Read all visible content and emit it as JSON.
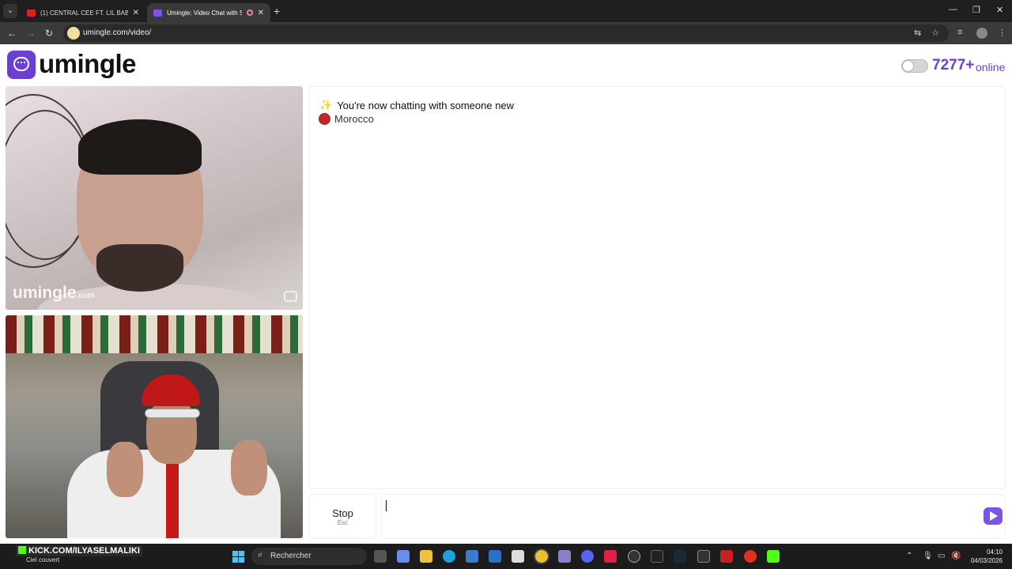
{
  "browser": {
    "tabs": [
      {
        "title": "(1) CENTRAL CEE FT. LIL BABY -",
        "favicon": "youtube-icon"
      },
      {
        "title": "Umingle: Video Chat with S",
        "favicon": "umingle-icon",
        "active": true
      }
    ],
    "url": "umingle.com/video/"
  },
  "header": {
    "logo_text": "umingle",
    "online_count": "7277+",
    "online_label": "online",
    "accent_color": "#6b3fd4"
  },
  "video": {
    "watermark_main": "umingle",
    "watermark_tld": ".com"
  },
  "chat": {
    "status_message": "You're now chatting with someone new",
    "country": "Morocco",
    "input_value": ""
  },
  "controls": {
    "stop_label": "Stop",
    "stop_shortcut": "Esc"
  },
  "taskbar": {
    "stream_overlay": "KICK.COM/ILYASELMALIKI",
    "weather_text": "Ciel couvert",
    "search_placeholder": "Rechercher",
    "time": "04:10",
    "date": "04/03/2026"
  }
}
